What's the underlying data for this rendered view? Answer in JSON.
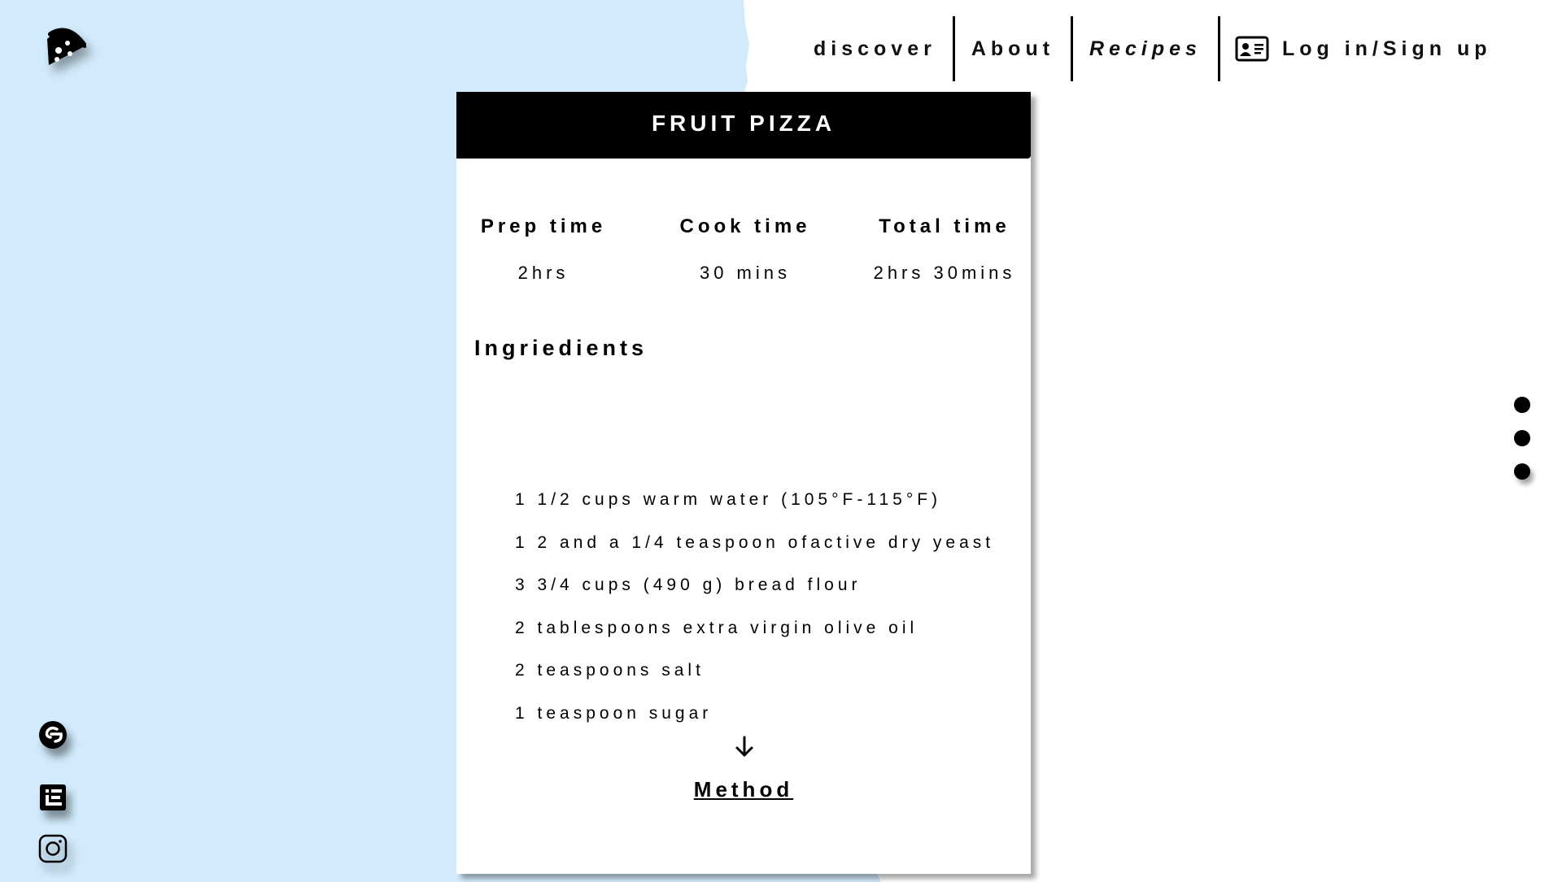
{
  "colors": {
    "background_left": "#d1ebfc",
    "background_right": "#ffffff",
    "header_bg": "#000000",
    "text": "#111111"
  },
  "logo": {
    "icon": "pizza-slice-icon"
  },
  "nav": {
    "discover": "discover",
    "about": "About",
    "recipes": "Recipes",
    "login_icon": "id-card-icon",
    "login": "Log in/Sign up"
  },
  "recipe": {
    "title": "FRUIT PIZZA",
    "times": [
      {
        "label": "Prep time",
        "value": "2hrs"
      },
      {
        "label": "Cook time",
        "value": "30 mins"
      },
      {
        "label": "Total time",
        "value": "2hrs 30mins"
      }
    ],
    "ingredients_heading": "Ingriedients",
    "ingredients": [
      "1 1/2 cups  warm water (105°F-115°F)",
      "1 2 and a 1/4 teaspoon ofactive dry yeast",
      "3 3/4 cups (490 g) bread flour",
      "2 tablespoons extra virgin olive oil",
      "2 teaspoons salt",
      "1 teaspoon sugar"
    ],
    "scroll_icon": "arrow-down-icon",
    "method_link": "Method"
  },
  "side_dots": {
    "count": 3,
    "icon": "carousel-dot-icon"
  },
  "social": [
    {
      "icon": "pinterest-like-icon"
    },
    {
      "icon": "menu-e-icon"
    },
    {
      "icon": "instagram-icon"
    }
  ]
}
